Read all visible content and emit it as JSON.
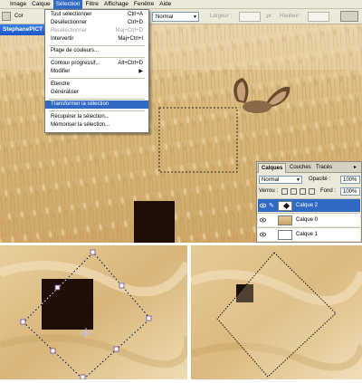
{
  "menubar": {
    "items": [
      {
        "label": "Image",
        "active": false
      },
      {
        "label": "Calque",
        "active": false
      },
      {
        "label": "Sélection",
        "active": true
      },
      {
        "label": "Filtre",
        "active": false
      },
      {
        "label": "Affichage",
        "active": false
      },
      {
        "label": "Fenêtre",
        "active": false
      },
      {
        "label": "Aide",
        "active": false
      }
    ]
  },
  "optionsbar": {
    "left_label": "Cor",
    "mode_value": "Normal",
    "width_label": "Largeur :",
    "height_label": "Hauteur :"
  },
  "document": {
    "title": "StephanePICT"
  },
  "selection_menu": {
    "items": [
      {
        "label": "Tout sélectionner",
        "shortcut": "Ctrl+A",
        "disabled": false,
        "highlight": false
      },
      {
        "label": "Désélectionner",
        "shortcut": "Ctrl+D",
        "disabled": false,
        "highlight": false
      },
      {
        "label": "Resélectionner",
        "shortcut": "Maj+Ctrl+D",
        "disabled": true,
        "highlight": false
      },
      {
        "label": "Intervertir",
        "shortcut": "Maj+Ctrl+I",
        "disabled": false,
        "highlight": false
      },
      {
        "label": "Plage de couleurs...",
        "shortcut": "",
        "disabled": false,
        "highlight": false
      },
      {
        "label": "Contour progressif...",
        "shortcut": "Alt+Ctrl+D",
        "disabled": false,
        "highlight": false
      },
      {
        "label": "Modifier",
        "shortcut": "",
        "disabled": false,
        "highlight": false,
        "submenu": true
      },
      {
        "label": "Etendre",
        "shortcut": "",
        "disabled": false,
        "highlight": false
      },
      {
        "label": "Généraliser",
        "shortcut": "",
        "disabled": false,
        "highlight": false
      },
      {
        "label": "Transformer la sélection",
        "shortcut": "",
        "disabled": false,
        "highlight": true
      },
      {
        "label": "Récupérer la sélection...",
        "shortcut": "",
        "disabled": false,
        "highlight": false
      },
      {
        "label": "Mémoriser la sélection...",
        "shortcut": "",
        "disabled": false,
        "highlight": false
      }
    ]
  },
  "layers_panel": {
    "tabs": [
      "Calques",
      "Couches",
      "Tracés"
    ],
    "active_tab": "Calques",
    "blend_mode": "Normal",
    "opacity_label": "Opacité :",
    "opacity_value": "100%",
    "lock_label": "Verrou :",
    "fill_label": "Fond :",
    "fill_value": "100%",
    "layers": [
      {
        "name": "Calque 2",
        "selected": true
      },
      {
        "name": "Calque 0",
        "selected": false
      },
      {
        "name": "Calque 1",
        "selected": false
      }
    ]
  },
  "colors": {
    "menu_highlight": "#316ac5",
    "square_fill": "#1e0e06",
    "wheat_light": "#e2c894",
    "wheat_mid": "#c9a466"
  }
}
